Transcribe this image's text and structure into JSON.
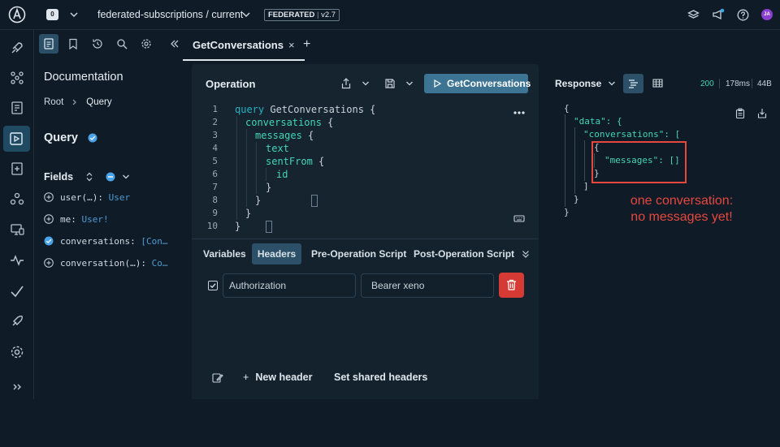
{
  "topbar": {
    "org_badge": "0",
    "graph_ref": "federated-subscriptions / current",
    "federation_badge": "FEDERATED",
    "version": "v2.7",
    "avatar_initials": "JA"
  },
  "doc": {
    "title": "Documentation",
    "breadcrumb_root": "Root",
    "breadcrumb_current": "Query",
    "type_name": "Query",
    "fields_label": "Fields",
    "fields": [
      {
        "name": "user(…): ",
        "type": "User",
        "selected": false
      },
      {
        "name": "me: ",
        "type": "User!",
        "selected": false
      },
      {
        "name": "conversations: ",
        "type": "[Con…",
        "selected": true
      },
      {
        "name": "conversation(…): ",
        "type": "Co…",
        "selected": false
      }
    ]
  },
  "tabs": [
    {
      "label": "GetConversations",
      "close": "×"
    }
  ],
  "tab_add": "+",
  "operation": {
    "title": "Operation",
    "run_label": "GetConversations",
    "line_numbers": [
      "1",
      "2",
      "3",
      "4",
      "5",
      "6",
      "7",
      "8",
      "9",
      "10"
    ],
    "code": {
      "l1_kw": "query",
      "l1_name": " GetConversations {",
      "l2": "conversations",
      "l2b": " {",
      "l3": "messages",
      "l3b": " {",
      "l4": "text",
      "l5": "sentFrom",
      "l5b": " {",
      "l6": "id",
      "l7": "}",
      "l8": "}",
      "l9": "}",
      "l10": "}"
    }
  },
  "variables_tabs": [
    "Variables",
    "Headers",
    "Pre-Operation Script",
    "Post-Operation Script"
  ],
  "headers": {
    "key": "Authorization",
    "value": "Bearer xeno"
  },
  "bottom": {
    "new_header": "New header",
    "new_header_plus": "+",
    "shared_headers": "Set shared headers"
  },
  "response": {
    "label": "Response",
    "status": "200",
    "time": "178ms",
    "size": "44B",
    "lines": [
      "{",
      "\"data\": {",
      "\"conversations\": [",
      "{",
      "\"messages\": []",
      "}",
      "]",
      "}",
      "}"
    ]
  },
  "annotation": {
    "line1": "one conversation:",
    "line2": "no messages yet!"
  },
  "colors": {
    "accent": "#3d7494",
    "annotation": "#e8473f",
    "delete": "#d63a34"
  }
}
